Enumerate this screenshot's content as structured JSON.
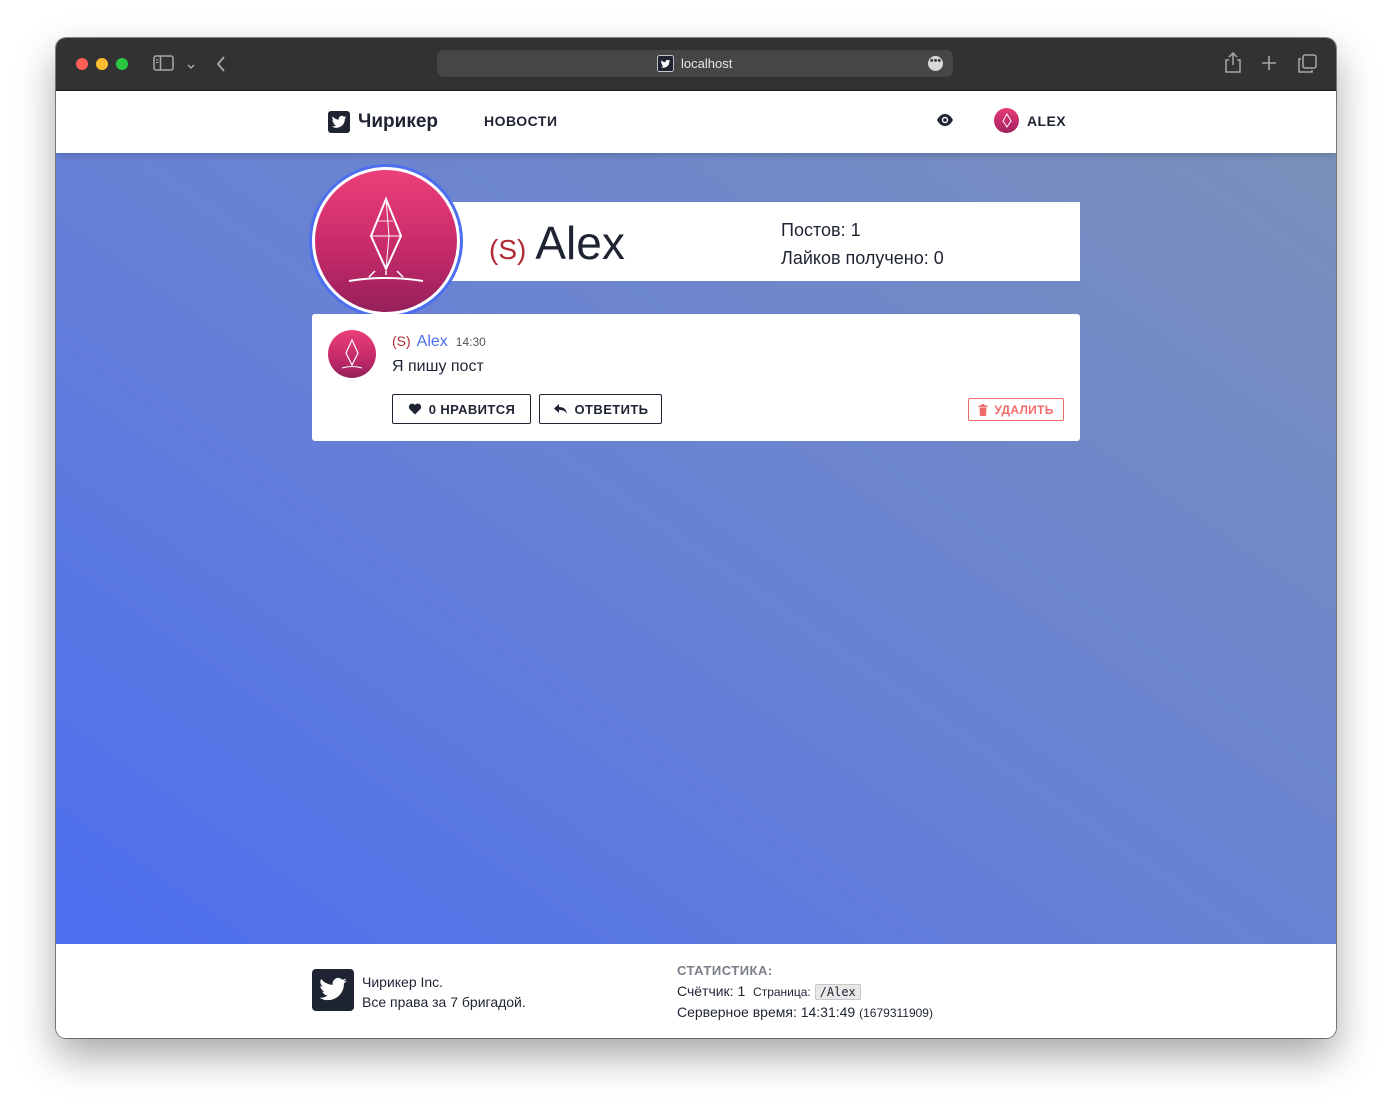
{
  "browser": {
    "url": "localhost",
    "more_glyph": "•••"
  },
  "navbar": {
    "brand": "Чирикер",
    "news": "НОВОСТИ",
    "username": "ALEX"
  },
  "profile": {
    "tag": "(S)",
    "name": "Alex",
    "posts_line": "Постов: 1",
    "likes_line": "Лайков получено: 0"
  },
  "post": {
    "tag": "(S)",
    "author": "Alex",
    "time": "14:30",
    "text": "Я пишу пост",
    "like_label": "0 НРАВИТСЯ",
    "reply_label": "ОТВЕТИТЬ",
    "delete_label": "УДАЛИТЬ"
  },
  "footer": {
    "company": "Чирикер Inc.",
    "rights": "Все права за 7 бригадой.",
    "stats_title": "СТАТИСТИКА:",
    "counter": "Счётчик: 1",
    "page_label": "Страница:",
    "page_path": "/Alex",
    "server_time_label": "Серверное время: 14:31:49",
    "server_timestamp": "(1679311909)"
  },
  "colors": {
    "accent": "#4c6ef0",
    "danger": "#f26b6b",
    "tag": "#b02a37",
    "dark": "#1f2433"
  },
  "icons": [
    "twitter-logo-icon",
    "eye-icon",
    "heart-icon",
    "reply-icon",
    "trash-icon",
    "sidebar-icon",
    "chevron-down-icon",
    "back-icon",
    "share-icon",
    "plus-icon",
    "tabs-icon",
    "crystal-avatar-icon"
  ]
}
